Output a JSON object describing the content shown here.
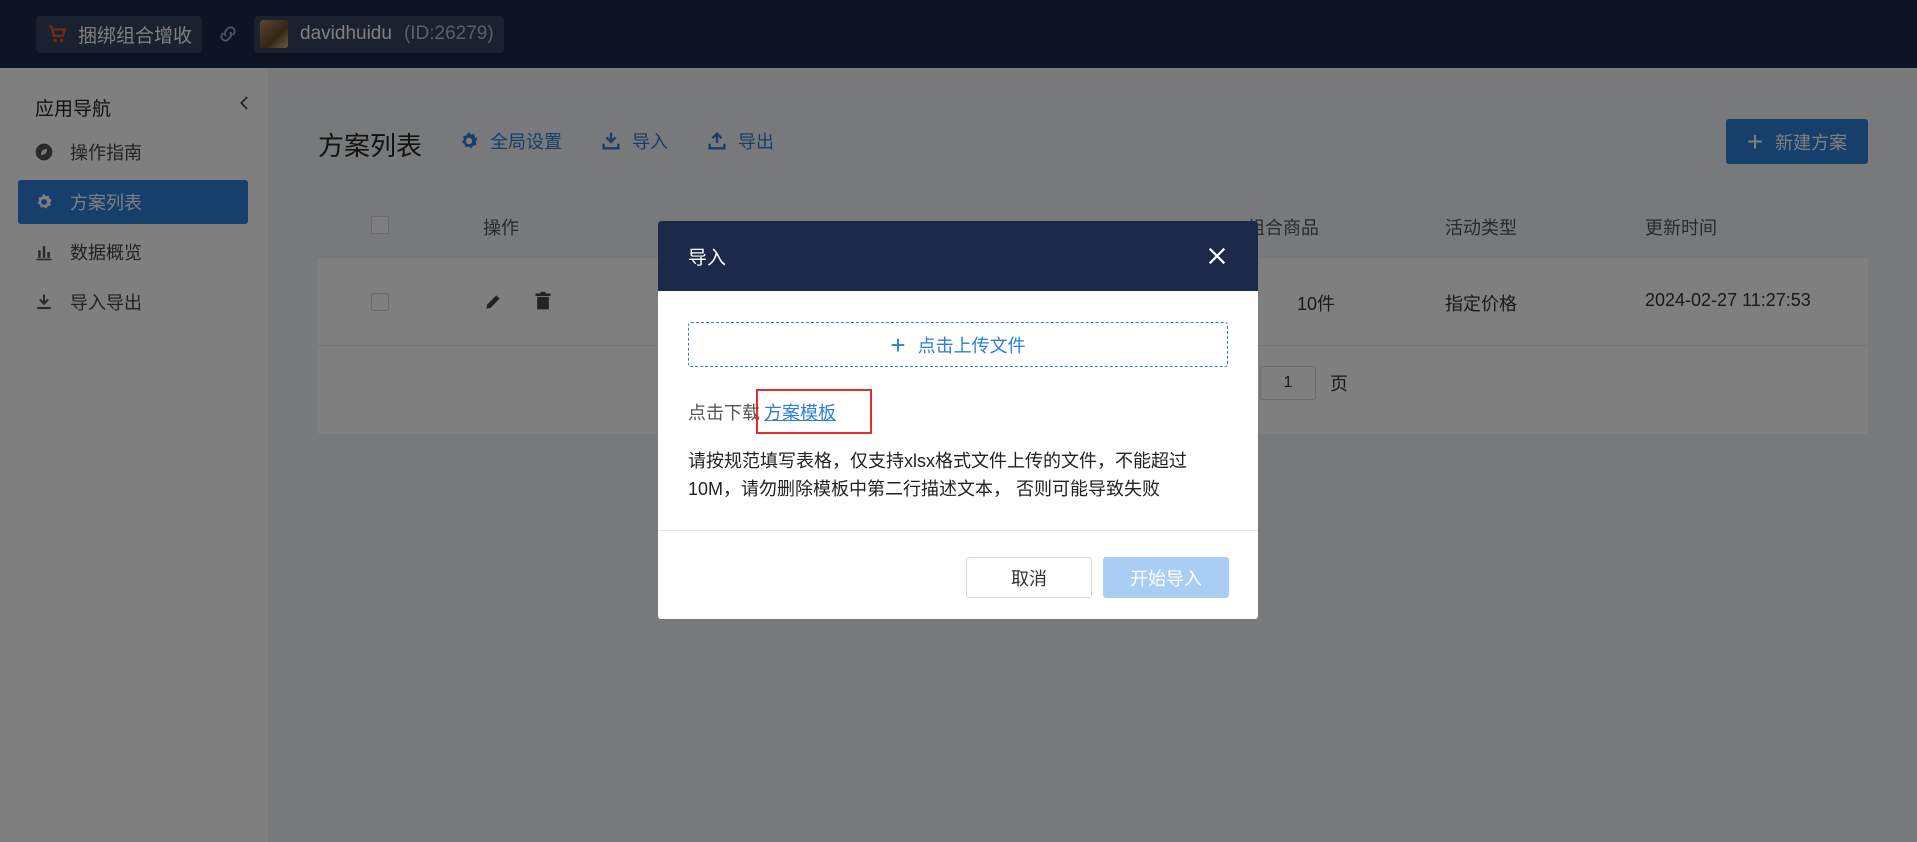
{
  "topbar": {
    "app_name": "捆绑组合增收",
    "user_name": "davidhuidu",
    "user_id": "(ID:26279)"
  },
  "sidebar": {
    "title": "应用导航",
    "items": [
      {
        "label": "操作指南",
        "icon": "compass-icon"
      },
      {
        "label": "方案列表",
        "icon": "gear-icon",
        "active": true
      },
      {
        "label": "数据概览",
        "icon": "bar-chart-icon"
      },
      {
        "label": "导入导出",
        "icon": "download-icon"
      }
    ]
  },
  "main": {
    "page_title": "方案列表",
    "toolbar": {
      "global_settings": "全局设置",
      "import": "导入",
      "export": "导出"
    },
    "new_plan_label": "新建方案",
    "table": {
      "headers": [
        "操作",
        "组合商品",
        "活动类型",
        "更新时间"
      ],
      "row": {
        "combo_goods": "10件",
        "activity_type": "指定价格",
        "updated_at": "2024-02-27 11:27:53"
      }
    },
    "pager": {
      "page": "1",
      "suffix": "页"
    }
  },
  "modal": {
    "title": "导入",
    "upload_label": "点击上传文件",
    "download_prefix": "点击下载",
    "template_link": "方案模板",
    "hint": "请按规范填写表格，仅支持xlsx格式文件上传的文件，不能超过10M，请勿删除模板中第二行描述文本， 否则可能导致失败",
    "cancel_label": "取消",
    "start_label": "开始导入"
  },
  "colors": {
    "topbar_bg": "#1b2a4a",
    "accent": "#2c7ed7",
    "highlight": "#e52b2b"
  }
}
